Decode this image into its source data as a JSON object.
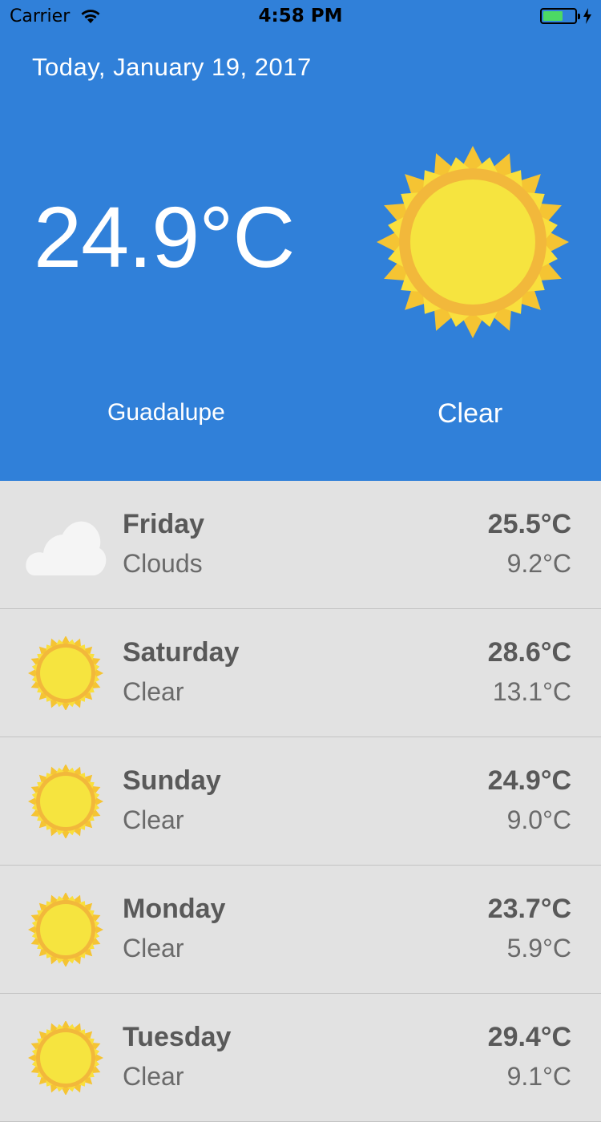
{
  "status_bar": {
    "carrier": "Carrier",
    "time": "4:58 PM",
    "battery_color": "#4cd964"
  },
  "current": {
    "date": "Today, January 19, 2017",
    "temperature": "24.9°C",
    "city": "Guadalupe",
    "condition": "Clear",
    "icon": "sun-icon",
    "background": "#3080d9"
  },
  "forecast": [
    {
      "day": "Friday",
      "condition": "Clouds",
      "high": "25.5°C",
      "low": "9.2°C",
      "icon": "cloud-icon"
    },
    {
      "day": "Saturday",
      "condition": "Clear",
      "high": "28.6°C",
      "low": "13.1°C",
      "icon": "sun-icon"
    },
    {
      "day": "Sunday",
      "condition": "Clear",
      "high": "24.9°C",
      "low": "9.0°C",
      "icon": "sun-icon"
    },
    {
      "day": "Monday",
      "condition": "Clear",
      "high": "23.7°C",
      "low": "5.9°C",
      "icon": "sun-icon"
    },
    {
      "day": "Tuesday",
      "condition": "Clear",
      "high": "29.4°C",
      "low": "9.1°C",
      "icon": "sun-icon"
    }
  ]
}
